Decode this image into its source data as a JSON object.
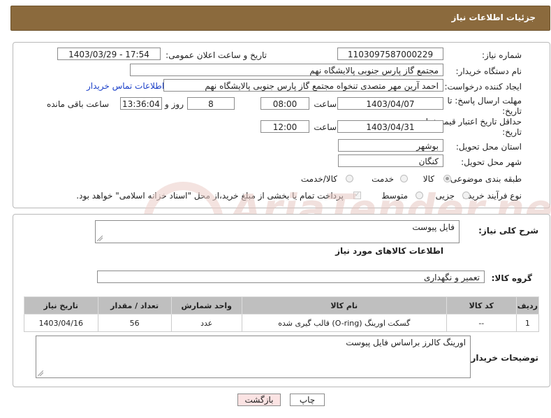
{
  "header": {
    "title": "جزئیات اطلاعات نیاز"
  },
  "form": {
    "need_number_label": "شماره نیاز:",
    "need_number": "1103097587000229",
    "announce_label": "تاریخ و ساعت اعلان عمومی:",
    "announce_value": "1403/03/29 - 17:54",
    "buyer_org_label": "نام دستگاه خریدار:",
    "buyer_org": "مجتمع گاز پارس جنوبی  پالایشگاه نهم",
    "creator_label": "ایجاد کننده درخواست:",
    "creator": "احمد آرین مهر متصدی تنخواه مجتمع گاز پارس جنوبی  پالایشگاه نهم",
    "buyer_contact_link": "اطلاعات تماس خریدار",
    "deadline_label": "مهلت ارسال پاسخ: تا تاریخ:",
    "deadline_date": "1403/04/07",
    "time_label": "ساعت",
    "deadline_time": "08:00",
    "days_value": "8",
    "days_label": "روز و",
    "remaining_time": "13:36:04",
    "remaining_label": "ساعت باقی مانده",
    "validity_label": "حداقل تاریخ اعتبار قیمت: تا تاریخ:",
    "validity_date": "1403/04/31",
    "validity_time": "12:00",
    "province_label": "استان محل تحویل:",
    "province": "بوشهر",
    "city_label": "شهر محل تحویل:",
    "city": "کنگان",
    "category_label": "طبقه بندی موضوعی:",
    "category_options": [
      "کالا",
      "خدمت",
      "کالا/خدمت"
    ],
    "process_label": "نوع فرآیند خرید :",
    "process_options": [
      "جزیی",
      "متوسط"
    ],
    "payment_note": "پرداخت تمام یا بخشی از مبلغ خرید،از محل \"اسناد خزانه اسلامی\" خواهد بود."
  },
  "summary": {
    "desc_label": "شرح کلی نیاز:",
    "desc_value": "فایل پیوست",
    "goods_info_title": "اطلاعات کالاهای مورد نیاز",
    "goods_group_label": "گروه کالا:",
    "goods_group": "تعمیر و نگهداری"
  },
  "table": {
    "headers": [
      "ردیف",
      "کد کالا",
      "نام کالا",
      "واحد شمارش",
      "تعداد / مقدار",
      "تاریخ نیاز"
    ],
    "rows": [
      [
        "1",
        "--",
        "گسکت اورینگ (O-ring) قالب گیری شده",
        "عدد",
        "56",
        "1403/04/16"
      ]
    ]
  },
  "buyer_notes": {
    "label": "توضیحات خریدار:",
    "value": "اورینگ کالرز براساس فایل پیوست"
  },
  "buttons": {
    "print": "چاپ",
    "back": "بازگشت"
  },
  "watermark": "AriaTender.net",
  "colors": {
    "header_bg": "#8b6a3d",
    "back_button_bg": "#fbe3e3",
    "table_header_bg": "#bfbfbf",
    "link": "#1a3fc8"
  }
}
